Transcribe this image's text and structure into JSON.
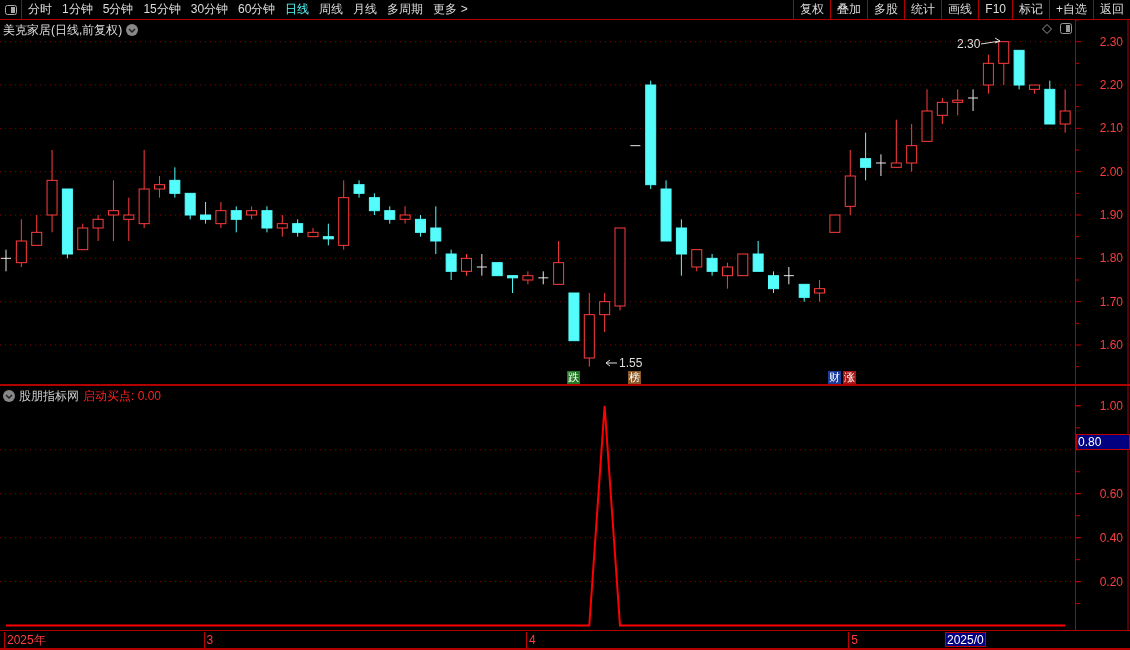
{
  "toolbar": {
    "periods": [
      {
        "label": "分时",
        "selected": false
      },
      {
        "label": "1分钟",
        "selected": false
      },
      {
        "label": "5分钟",
        "selected": false
      },
      {
        "label": "15分钟",
        "selected": false
      },
      {
        "label": "30分钟",
        "selected": false
      },
      {
        "label": "60分钟",
        "selected": false
      },
      {
        "label": "日线",
        "selected": true
      },
      {
        "label": "周线",
        "selected": false
      },
      {
        "label": "月线",
        "selected": false
      },
      {
        "label": "多周期",
        "selected": false
      },
      {
        "label": "更多 >",
        "selected": false
      }
    ],
    "buttons": [
      "复权",
      "叠加",
      "多股",
      "统计",
      "画线",
      "F10",
      "标记",
      "+自选",
      "返回"
    ]
  },
  "price_panel": {
    "title": "美克家居(日线,前复权)",
    "high_label": "2.30",
    "low_label": "1.55",
    "signals": [
      {
        "label": "跌",
        "color": "#207a20"
      },
      {
        "label": "榜",
        "color": "#8a5a28"
      },
      {
        "label": "财",
        "color": "#1c3c9c"
      },
      {
        "label": "涨",
        "color": "#a81414"
      }
    ],
    "chart_data": {
      "type": "candlestick",
      "grid": true,
      "ylim": [
        1.51,
        2.35
      ],
      "yticks": [
        {
          "value": 2.3,
          "label": "2.30"
        },
        {
          "value": 2.2,
          "label": "2.20"
        },
        {
          "value": 2.1,
          "label": "2.10"
        },
        {
          "value": 2.0,
          "label": "2.00"
        },
        {
          "value": 1.9,
          "label": "1.90"
        },
        {
          "value": 1.8,
          "label": "1.80"
        },
        {
          "value": 1.7,
          "label": "1.70"
        },
        {
          "value": 1.6,
          "label": "1.60"
        }
      ],
      "ohlc": [
        [
          1.8,
          1.82,
          1.77,
          1.8
        ],
        [
          1.79,
          1.89,
          1.78,
          1.84
        ],
        [
          1.83,
          1.9,
          1.83,
          1.86
        ],
        [
          1.9,
          2.05,
          1.86,
          1.98
        ],
        [
          1.96,
          1.96,
          1.8,
          1.81
        ],
        [
          1.82,
          1.88,
          1.82,
          1.87
        ],
        [
          1.87,
          1.9,
          1.84,
          1.89
        ],
        [
          1.9,
          1.98,
          1.84,
          1.91
        ],
        [
          1.89,
          1.94,
          1.84,
          1.9
        ],
        [
          1.88,
          2.05,
          1.87,
          1.96
        ],
        [
          1.96,
          1.99,
          1.94,
          1.97
        ],
        [
          1.98,
          2.01,
          1.94,
          1.95
        ],
        [
          1.95,
          1.95,
          1.89,
          1.9
        ],
        [
          1.9,
          1.93,
          1.88,
          1.89
        ],
        [
          1.88,
          1.93,
          1.87,
          1.91
        ],
        [
          1.91,
          1.92,
          1.86,
          1.89
        ],
        [
          1.9,
          1.92,
          1.89,
          1.91
        ],
        [
          1.91,
          1.92,
          1.86,
          1.87
        ],
        [
          1.87,
          1.9,
          1.85,
          1.88
        ],
        [
          1.88,
          1.89,
          1.85,
          1.86
        ],
        [
          1.85,
          1.87,
          1.85,
          1.86
        ],
        [
          1.85,
          1.88,
          1.83,
          1.845
        ],
        [
          1.83,
          1.98,
          1.82,
          1.94
        ],
        [
          1.97,
          1.98,
          1.94,
          1.95
        ],
        [
          1.94,
          1.95,
          1.9,
          1.91
        ],
        [
          1.91,
          1.92,
          1.88,
          1.89
        ],
        [
          1.89,
          1.92,
          1.88,
          1.9
        ],
        [
          1.89,
          1.9,
          1.85,
          1.86
        ],
        [
          1.87,
          1.92,
          1.81,
          1.84
        ],
        [
          1.81,
          1.82,
          1.75,
          1.77
        ],
        [
          1.77,
          1.81,
          1.76,
          1.8
        ],
        [
          1.78,
          1.81,
          1.76,
          1.78
        ],
        [
          1.79,
          1.79,
          1.76,
          1.76
        ],
        [
          1.76,
          1.76,
          1.72,
          1.755
        ],
        [
          1.75,
          1.77,
          1.74,
          1.76
        ],
        [
          1.755,
          1.77,
          1.74,
          1.755
        ],
        [
          1.74,
          1.84,
          1.74,
          1.79
        ],
        [
          1.72,
          1.72,
          1.61,
          1.61
        ],
        [
          1.57,
          1.72,
          1.55,
          1.67
        ],
        [
          1.67,
          1.72,
          1.63,
          1.7
        ],
        [
          1.69,
          1.87,
          1.68,
          1.87
        ],
        [
          2.06,
          2.06,
          2.06,
          2.06
        ],
        [
          2.2,
          2.21,
          1.96,
          1.97
        ],
        [
          1.96,
          1.98,
          1.84,
          1.84
        ],
        [
          1.87,
          1.89,
          1.76,
          1.81
        ],
        [
          1.78,
          1.82,
          1.77,
          1.82
        ],
        [
          1.8,
          1.81,
          1.76,
          1.77
        ],
        [
          1.76,
          1.79,
          1.73,
          1.78
        ],
        [
          1.76,
          1.81,
          1.76,
          1.81
        ],
        [
          1.81,
          1.84,
          1.77,
          1.77
        ],
        [
          1.76,
          1.77,
          1.72,
          1.73
        ],
        [
          1.76,
          1.78,
          1.74,
          1.76
        ],
        [
          1.74,
          1.74,
          1.7,
          1.71
        ],
        [
          1.72,
          1.75,
          1.7,
          1.73
        ],
        [
          1.86,
          1.9,
          1.86,
          1.9
        ],
        [
          1.92,
          2.05,
          1.9,
          1.99
        ],
        [
          2.03,
          2.09,
          1.98,
          2.01
        ],
        [
          2.02,
          2.04,
          1.99,
          2.02
        ],
        [
          2.01,
          2.12,
          2.01,
          2.02
        ],
        [
          2.02,
          2.11,
          2.0,
          2.06
        ],
        [
          2.07,
          2.19,
          2.07,
          2.14
        ],
        [
          2.13,
          2.17,
          2.11,
          2.16
        ],
        [
          2.16,
          2.19,
          2.13,
          2.165
        ],
        [
          2.17,
          2.19,
          2.14,
          2.17
        ],
        [
          2.2,
          2.27,
          2.18,
          2.25
        ],
        [
          2.25,
          2.3,
          2.2,
          2.3
        ],
        [
          2.28,
          2.28,
          2.19,
          2.2
        ],
        [
          2.19,
          2.2,
          2.18,
          2.2
        ],
        [
          2.19,
          2.21,
          2.11,
          2.11
        ],
        [
          2.11,
          2.19,
          2.09,
          2.14
        ]
      ]
    }
  },
  "indicator_panel": {
    "name": "股朋指标网",
    "legend": "启动买点: 0.00",
    "cursor_value": "0.80",
    "chart_data": {
      "type": "line",
      "grid": true,
      "ylim": [
        -0.02,
        1.09
      ],
      "yticks": [
        {
          "value": 0.2,
          "label": "0.20"
        },
        {
          "value": 0.4,
          "label": "0.40"
        },
        {
          "value": 0.6,
          "label": "0.60"
        },
        {
          "value": 1.0,
          "label": "1.00"
        }
      ],
      "series": [
        {
          "color": "#ff0000",
          "values": [
            0,
            0,
            0,
            0,
            0,
            0,
            0,
            0,
            0,
            0,
            0,
            0,
            0,
            0,
            0,
            0,
            0,
            0,
            0,
            0,
            0,
            0,
            0,
            0,
            0,
            0,
            0,
            0,
            0,
            0,
            0,
            0,
            0,
            0,
            0,
            0,
            0,
            0,
            0,
            1,
            0,
            0,
            0,
            0,
            0,
            0,
            0,
            0,
            0,
            0,
            0,
            0,
            0,
            0,
            0,
            0,
            0,
            0,
            0,
            0,
            0,
            0,
            0,
            0,
            0,
            0,
            0,
            0,
            0,
            0
          ]
        }
      ]
    }
  },
  "time_axis": {
    "labels": [
      "2025年",
      "3",
      "4",
      "5"
    ],
    "cursor_date": "2025/0"
  }
}
